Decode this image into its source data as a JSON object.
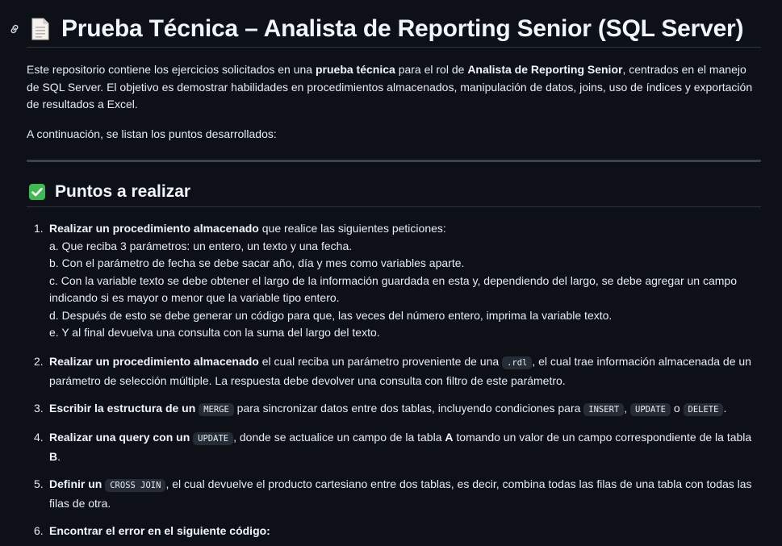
{
  "header": {
    "anchor_icon": "link-icon",
    "doc_icon": "page-facing-up-icon",
    "title": "Prueba Técnica – Analista de Reporting Senior (SQL Server)"
  },
  "intro": {
    "p1_a": "Este repositorio contiene los ejercicios solicitados en una ",
    "p1_b": "prueba técnica",
    "p1_c": " para el rol de ",
    "p1_d": "Analista de Reporting Senior",
    "p1_e": ", centrados en el manejo de SQL Server. El objetivo es demostrar habilidades en procedimientos almacenados, manipulación de datos, joins, uso de índices y exportación de resultados a Excel.",
    "p2": "A continuación, se listan los puntos desarrollados:"
  },
  "section": {
    "icon": "check-mark-button-icon",
    "title": "Puntos a realizar"
  },
  "items": [
    {
      "num": "1.",
      "bold": "Realizar un procedimiento almacenado",
      "rest": " que realice las siguientes peticiones:",
      "subs": [
        "a. Que reciba 3 parámetros: un entero, un texto y una fecha.",
        "b. Con el parámetro de fecha se debe sacar año, día y mes como variables aparte.",
        "c. Con la variable texto se debe obtener el largo de la información guardada en esta y, dependiendo del largo, se debe agregar un campo indicando si es mayor o menor que la variable tipo entero.",
        "d. Después de esto se debe generar un código para que, las veces del número entero, imprima la variable texto.",
        "e. Y al final devuelva una consulta con la suma del largo del texto."
      ]
    },
    {
      "num": "2.",
      "bold": "Realizar un procedimiento almacenado",
      "rest_a": " el cual reciba un parámetro proveniente de una ",
      "code": ".rdl",
      "rest_b": ", el cual trae información almacenada de un parámetro de selección múltiple. La respuesta debe devolver una consulta con filtro de este parámetro."
    },
    {
      "num": "3.",
      "bold": "Escribir la estructura de un",
      "code1": "MERGE",
      "rest_a": " para sincronizar datos entre dos tablas, incluyendo condiciones para ",
      "code2": "INSERT",
      "sep1": ", ",
      "code3": "UPDATE",
      "sep2": " o ",
      "code4": "DELETE",
      "end": "."
    },
    {
      "num": "4.",
      "bold": "Realizar una query con un",
      "code": "UPDATE",
      "rest_a": ", donde se actualice un campo de la tabla ",
      "bold_a": "A",
      "rest_b": " tomando un valor de un campo correspondiente de la tabla ",
      "bold_b": "B",
      "end": "."
    },
    {
      "num": "5.",
      "bold": "Definir un",
      "code": "CROSS JOIN",
      "rest": ", el cual devuelve el producto cartesiano entre dos tablas, es decir, combina todas las filas de una tabla con todas las filas de otra."
    },
    {
      "num": "6.",
      "bold": "Encontrar el error en el siguiente código:"
    }
  ]
}
